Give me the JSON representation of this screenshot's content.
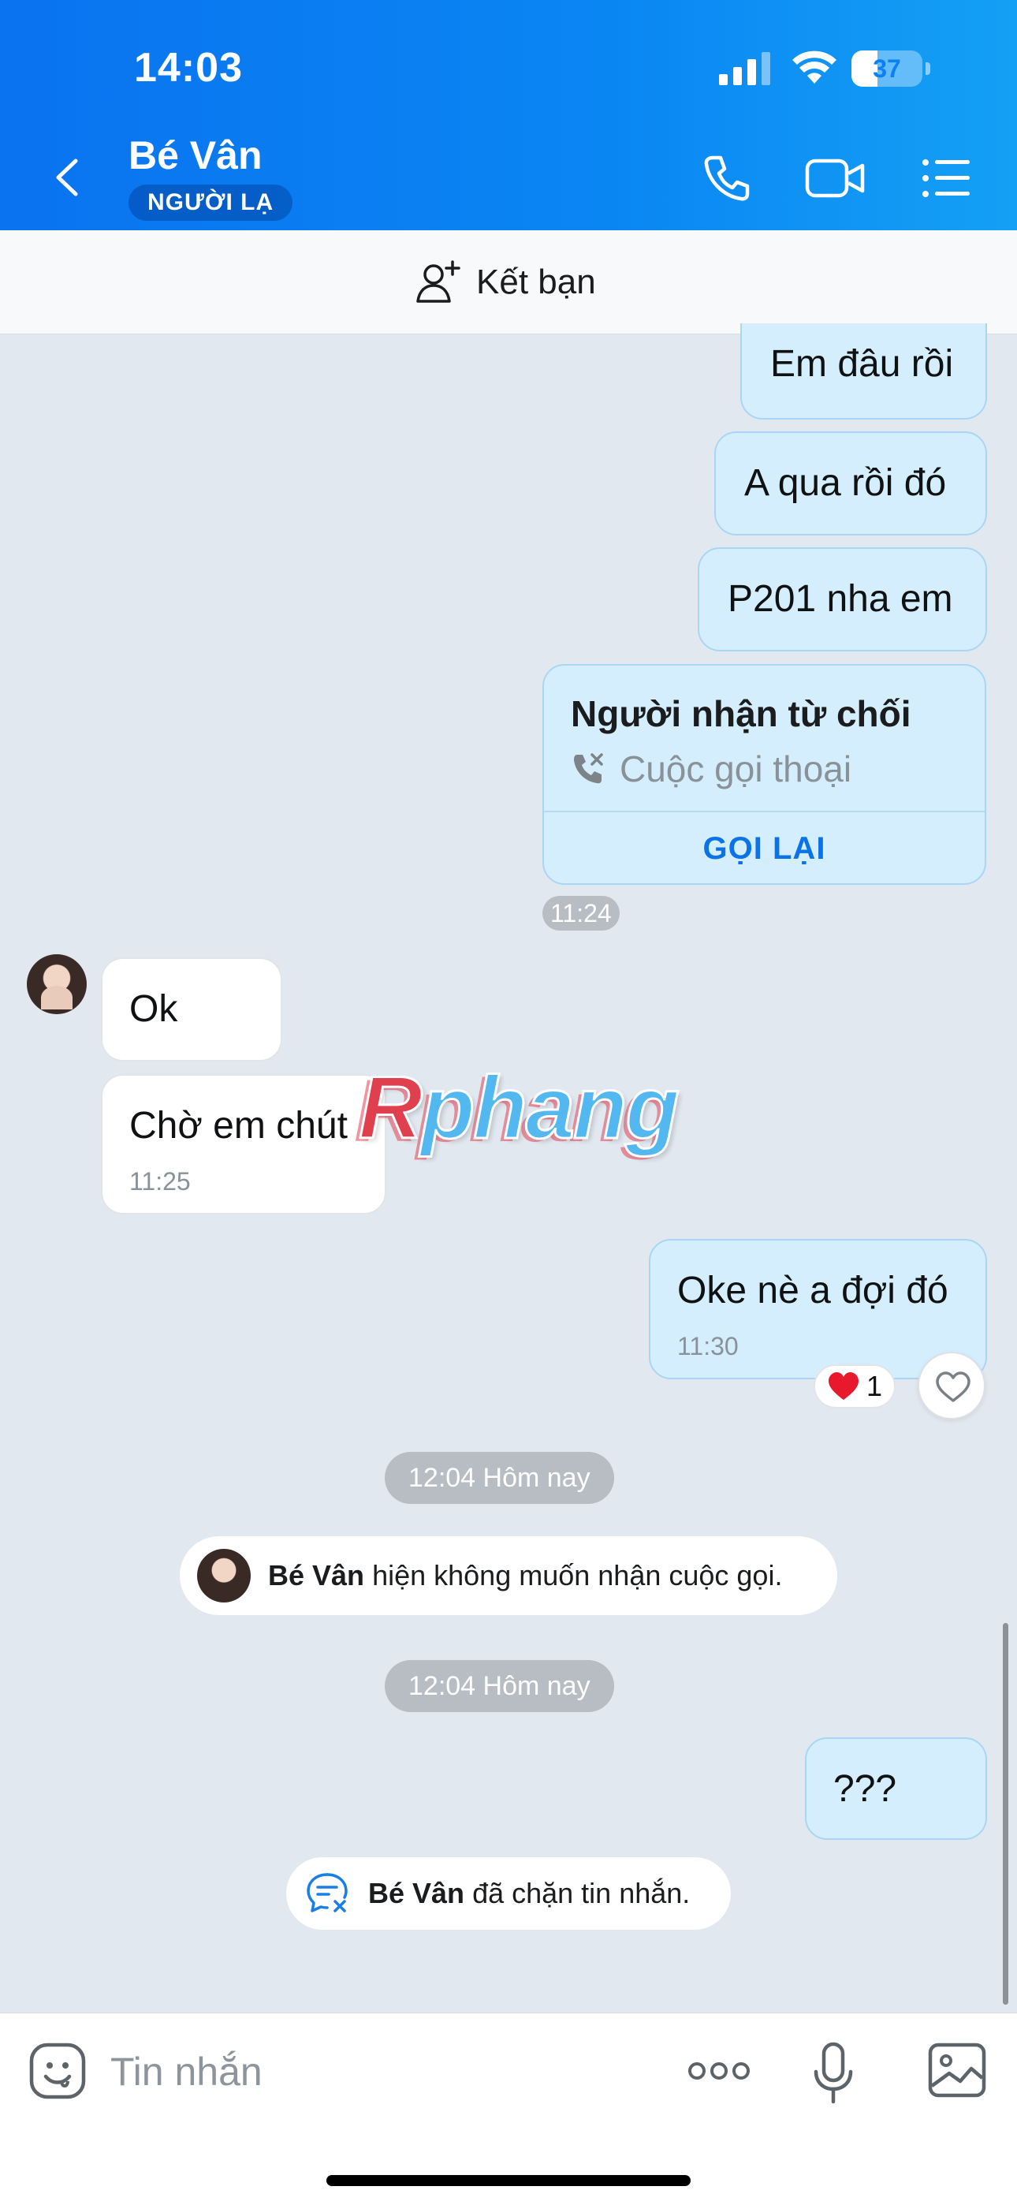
{
  "status_bar": {
    "time": "14:03",
    "battery": "37",
    "battery_level_percent": 37
  },
  "header": {
    "contact_name": "Bé Vân",
    "badge": "NGƯỜI LẠ",
    "icons": [
      "chevron-left-icon",
      "phone-icon",
      "video-camera-icon",
      "list-menu-icon"
    ]
  },
  "friend_bar": {
    "label": "Kết bạn",
    "icon": "add-person-icon"
  },
  "messages": [
    {
      "dir": "out",
      "text": "Em đâu rồi"
    },
    {
      "dir": "out",
      "text": "A qua rồi đó"
    },
    {
      "dir": "out",
      "text": "P201 nha em"
    },
    {
      "dir": "out",
      "type": "call",
      "title": "Người nhận từ chối",
      "subtitle": "Cuộc gọi thoại",
      "action": "GỌI LẠI"
    },
    {
      "dir": "out",
      "time_pill": "11:24"
    },
    {
      "dir": "in",
      "text": "Ok"
    },
    {
      "dir": "in",
      "text": "Chờ em chút",
      "time": "11:25"
    },
    {
      "dir": "out",
      "text": "Oke nè a đợi đó",
      "time": "11:30",
      "reaction": {
        "emoji": "heart",
        "count": "1"
      }
    },
    {
      "dir": "out",
      "text": "???"
    }
  ],
  "day_pills": [
    "12:04 Hôm nay",
    "12:04 Hôm nay"
  ],
  "system_notes": [
    {
      "name": "Bé Vân",
      "text": "hiện không muốn nhận cuộc gọi."
    },
    {
      "name": "Bé Vân",
      "text": "đã chặn tin nhắn."
    }
  ],
  "watermark": {
    "first": "R",
    "rest": "phang"
  },
  "composer": {
    "placeholder": "Tin nhắn",
    "icons": [
      "emoji-icon",
      "more-dots-icon",
      "microphone-icon",
      "image-icon"
    ]
  },
  "colors": {
    "header": "#0a80f2",
    "outgoing_bubble": "#d4eefd",
    "incoming_bubble": "#ffffff",
    "background": "#e2e8f0",
    "accent": "#0a73e8"
  }
}
